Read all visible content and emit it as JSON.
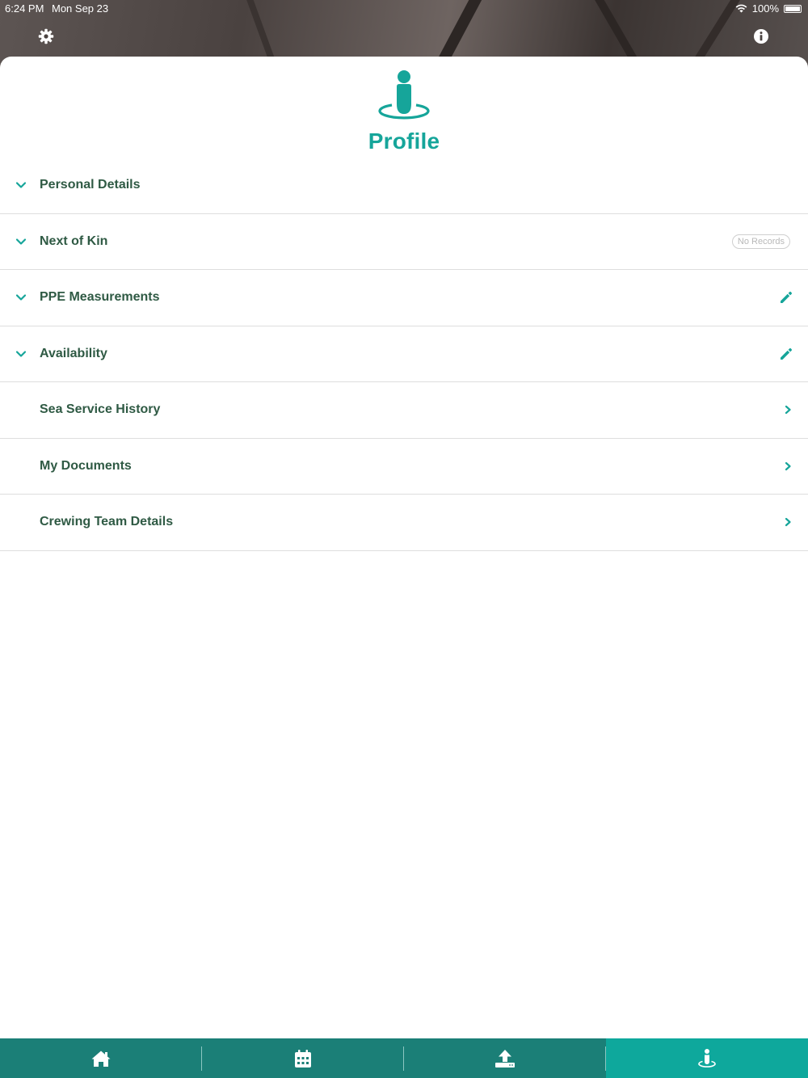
{
  "status_bar": {
    "time": "6:24 PM",
    "date": "Mon Sep 23",
    "battery": "100%"
  },
  "header": {
    "settings_icon": "gear-icon",
    "info_icon": "info-icon"
  },
  "profile": {
    "title": "Profile",
    "icon": "person-on-ring-icon"
  },
  "sections": [
    {
      "label": "Personal Details",
      "expandable": true,
      "right": "none"
    },
    {
      "label": "Next of Kin",
      "expandable": true,
      "right": "badge",
      "badge": "No Records"
    },
    {
      "label": "PPE Measurements",
      "expandable": true,
      "right": "pencil-icon"
    },
    {
      "label": "Availability",
      "expandable": true,
      "right": "pencil-icon"
    },
    {
      "label": "Sea Service History",
      "expandable": false,
      "right": "chevron-right-icon"
    },
    {
      "label": "My Documents",
      "expandable": false,
      "right": "chevron-right-icon"
    },
    {
      "label": "Crewing Team Details",
      "expandable": false,
      "right": "chevron-right-icon"
    }
  ],
  "tabbar": {
    "tabs": [
      {
        "icon": "home-icon"
      },
      {
        "icon": "calendar-icon"
      },
      {
        "icon": "upload-icon"
      },
      {
        "icon": "profile-icon",
        "active": true
      }
    ]
  },
  "colors": {
    "accent": "#16a59a",
    "label": "#2f5a44",
    "tabbar": "#1b7f77",
    "tabbar_active": "#0ea89c"
  }
}
